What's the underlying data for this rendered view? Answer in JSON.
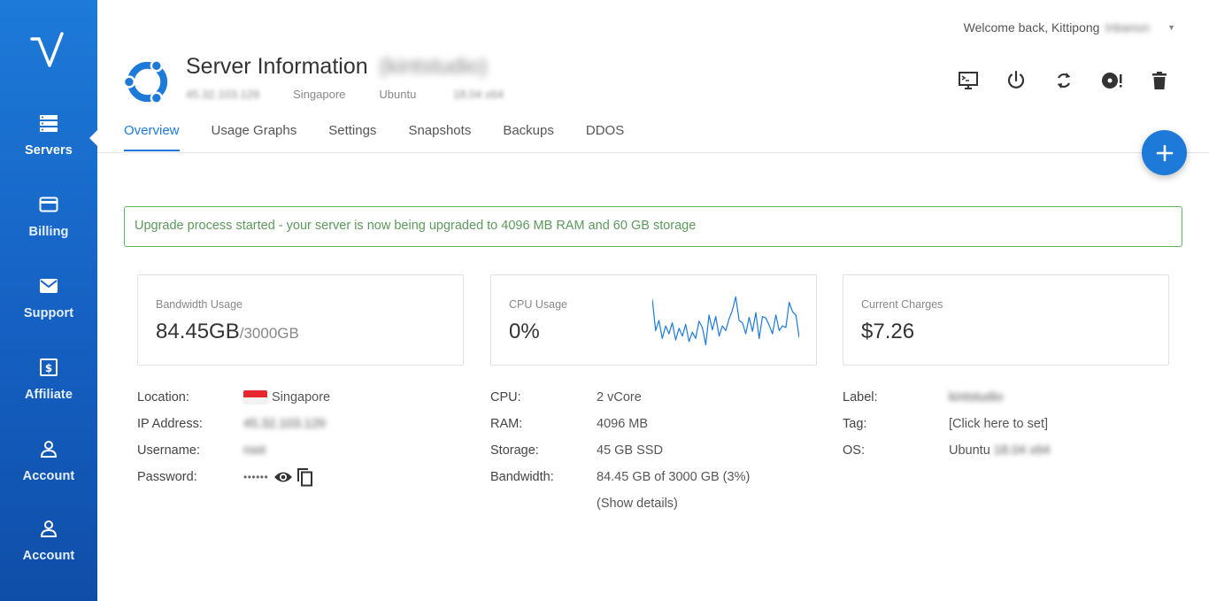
{
  "sidebar": {
    "items": [
      {
        "label": "Servers",
        "icon": "servers-icon",
        "active": true
      },
      {
        "label": "Billing",
        "icon": "credit-card-icon"
      },
      {
        "label": "Support",
        "icon": "envelope-icon"
      },
      {
        "label": "Affiliate",
        "icon": "dollar-bill-icon"
      },
      {
        "label": "Account",
        "icon": "user-icon"
      },
      {
        "label": "Account",
        "icon": "user-icon"
      }
    ]
  },
  "header": {
    "welcome": "Welcome back, Kittipong",
    "welcome_surname": "Inbanon",
    "title": "Server Information",
    "server_name": "(kintstudio)",
    "ip": "45.32.103.129",
    "region": "Singapore",
    "os_name": "Ubuntu",
    "os_version": "18.04 x64"
  },
  "actions": [
    {
      "name": "console-icon"
    },
    {
      "name": "power-icon"
    },
    {
      "name": "restart-icon"
    },
    {
      "name": "reinstall-disc-icon"
    },
    {
      "name": "trash-icon"
    }
  ],
  "tabs": [
    "Overview",
    "Usage Graphs",
    "Settings",
    "Snapshots",
    "Backups",
    "DDOS"
  ],
  "alert": "Upgrade process started - your server is now being upgraded to 4096 MB RAM and 60 GB storage",
  "cards": {
    "bandwidth": {
      "caption": "Bandwidth Usage",
      "value": "84.45GB",
      "suffix": "/3000GB"
    },
    "cpu": {
      "caption": "CPU Usage",
      "value": "0%"
    },
    "charges": {
      "caption": "Current Charges",
      "value": "$7.26"
    }
  },
  "cpu_spark": [
    8,
    48,
    35,
    58,
    42,
    52,
    38,
    60,
    45,
    55,
    40,
    62,
    50,
    58,
    36,
    44,
    66,
    28,
    47,
    30,
    55,
    42,
    48,
    33,
    22,
    5,
    35,
    38,
    52,
    31,
    49,
    25,
    58,
    30,
    32,
    41,
    52,
    28,
    48,
    42,
    44,
    12,
    24,
    28,
    57
  ],
  "info_left": {
    "location_label": "Location:",
    "location_value": "Singapore",
    "ip_label": "IP Address:",
    "ip_value": "45.32.103.129",
    "username_label": "Username:",
    "username_value": "root",
    "password_label": "Password:",
    "password_value": "••••••"
  },
  "info_mid": {
    "cpu_label": "CPU:",
    "cpu_value": "2 vCore",
    "ram_label": "RAM:",
    "ram_value": "4096 MB",
    "storage_label": "Storage:",
    "storage_value": "45 GB SSD",
    "bandwidth_label": "Bandwidth:",
    "bandwidth_value": "84.45 GB of 3000 GB (3%)",
    "show_details": "(Show details)"
  },
  "info_right": {
    "label_label": "Label:",
    "label_value": "kintstudio",
    "tag_label": "Tag:",
    "tag_value": "[Click here to set]",
    "os_label": "OS:",
    "os_value": "Ubuntu",
    "os_version": "18.04 x64"
  },
  "colors": {
    "brand": "#1d7ad8",
    "alert_green": "#5cb85c"
  }
}
